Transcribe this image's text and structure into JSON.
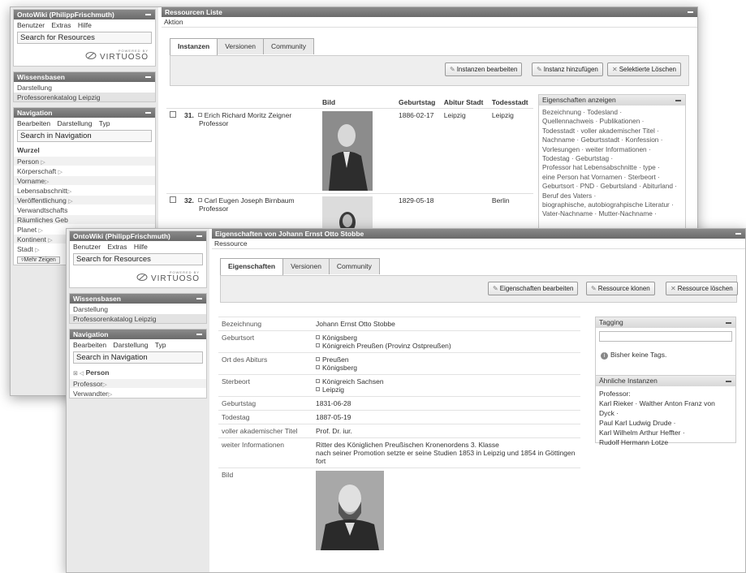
{
  "back": {
    "sidebar": {
      "ontowiki": {
        "title": "OntoWiki (PhilippFrischmuth)",
        "menu": [
          "Benutzer",
          "Extras",
          "Hilfe"
        ],
        "search": "Search for Resources",
        "powered_by": "POWERED BY",
        "brand": "VIRTUOSO"
      },
      "wissensbasen": {
        "title": "Wissensbasen",
        "items": [
          "Darstellung",
          "Professorenkatalog Leipzig"
        ]
      },
      "navigation": {
        "title": "Navigation",
        "menu": [
          "Bearbeiten",
          "Darstellung",
          "Typ"
        ],
        "search": "Search in Navigation",
        "root": "Wurzel",
        "items": [
          "Person",
          "Körperschaft",
          "Vorname",
          "Lebensabschnitt",
          "Veröffentlichung",
          "Verwandtschafts",
          "Räumliches Geb",
          "Planet",
          "Kontinent",
          "Stadt"
        ],
        "more": "Mehr Zeigen"
      }
    },
    "main": {
      "title": "Ressourcen Liste",
      "action": "Aktion",
      "tabs": [
        "Instanzen",
        "Versionen",
        "Community"
      ],
      "buttons": [
        "Instanzen bearbeiten",
        "Instanz hinzufügen",
        "Selektierte Löschen"
      ],
      "columns": [
        "Bild",
        "Geburtstag",
        "Abitur Stadt",
        "Todesstadt"
      ],
      "rows": [
        {
          "num": "31.",
          "name": "Erich Richard Moritz Zeigner",
          "role": "Professor",
          "birthday": "1886-02-17",
          "abitur": "Leipzig",
          "death": "Leipzig"
        },
        {
          "num": "32.",
          "name": "Carl Eugen Joseph Birnbaum",
          "role": "Professor",
          "birthday": "1829-05-18",
          "abitur": "",
          "death": "Berlin"
        }
      ],
      "eigenschaften": {
        "title": "Eigenschaften anzeigen",
        "lines": [
          "Bezeichnung · Todesland ·",
          "Quellennachweis · Publikationen ·",
          "Todesstadt · voller akademischer Titel ·",
          "Nachname · Geburtsstadt · Konfession ·",
          "Vorlesungen · weiter Informationen ·",
          "Todestag · Geburtstag ·",
          "Professor hat Lebensabschnitte · type ·",
          "eine Person hat Vornamen · Sterbeort ·",
          "Geburtsort · PND · Geburtsland · Abiturland ·",
          "Beruf des Vaters ·",
          "biographische, autobiograhpische Literatur ·",
          "Vater-Nachname · Mutter-Nachname ·"
        ]
      }
    }
  },
  "front": {
    "sidebar": {
      "ontowiki": {
        "title": "OntoWiki (PhilippFrischmuth)",
        "menu": [
          "Benutzer",
          "Extras",
          "Hilfe"
        ],
        "search": "Search for Resources",
        "powered_by": "POWERED BY",
        "brand": "VIRTUOSO"
      },
      "wissensbasen": {
        "title": "Wissensbasen",
        "items": [
          "Darstellung",
          "Professorenkatalog Leipzig"
        ]
      },
      "navigation": {
        "title": "Navigation",
        "menu": [
          "Bearbeiten",
          "Darstellung",
          "Typ"
        ],
        "search": "Search in Navigation",
        "crumb_prefix": "⊠ ◁",
        "current": "Person",
        "items": [
          "Professor",
          "Verwandter"
        ]
      }
    },
    "main": {
      "title": "Eigenschaften von Johann Ernst Otto Stobbe",
      "action": "Ressource",
      "tabs": [
        "Eigenschaften",
        "Versionen",
        "Community"
      ],
      "buttons": [
        "Eigenschaften bearbeiten",
        "Ressource klonen",
        "Ressource löschen"
      ],
      "properties": [
        {
          "key": "Bezeichnung",
          "values": [
            "Johann Ernst Otto Stobbe"
          ],
          "bullets": false
        },
        {
          "key": "Geburtsort",
          "values": [
            "Königsberg",
            "Königreich Preußen (Provinz Ostpreußen)"
          ],
          "bullets": true
        },
        {
          "key": "Ort des Abiturs",
          "values": [
            "Preußen",
            "Königsberg"
          ],
          "bullets": true
        },
        {
          "key": "Sterbeort",
          "values": [
            "Königreich Sachsen",
            "Leipzig"
          ],
          "bullets": true
        },
        {
          "key": "Geburtstag",
          "values": [
            "1831-06-28"
          ],
          "bullets": false
        },
        {
          "key": "Todestag",
          "values": [
            "1887-05-19"
          ],
          "bullets": false
        },
        {
          "key": "voller akademischer Titel",
          "values": [
            "Prof. Dr. iur."
          ],
          "bullets": false
        },
        {
          "key": "weiter Informationen",
          "values": [
            "Ritter des Königlichen Preußischen Kronenordens 3. Klasse",
            "nach seiner Promotion setzte er seine Studien 1853 in Leipzig und 1854 in Göttingen fort"
          ],
          "bullets": false
        },
        {
          "key": "Bild",
          "values": [],
          "bullets": false
        }
      ],
      "tagging": {
        "title": "Tagging",
        "none": "Bisher keine Tags."
      },
      "similar": {
        "title": "Ähnliche Instanzen",
        "label": "Professor:",
        "lines": [
          "Karl Rieker · Walther Anton Franz von Dyck ·",
          "Paul Karl Ludwig Drude ·",
          "Karl Wilhelm Arthur Heffter ·",
          "Rudolf Hermann Lotze"
        ]
      }
    }
  },
  "icons": {
    "edit": "pencil-icon",
    "add": "add-icon",
    "delete": "delete-x-icon",
    "info": "info-icon",
    "arrow": "triangle-right-icon"
  }
}
